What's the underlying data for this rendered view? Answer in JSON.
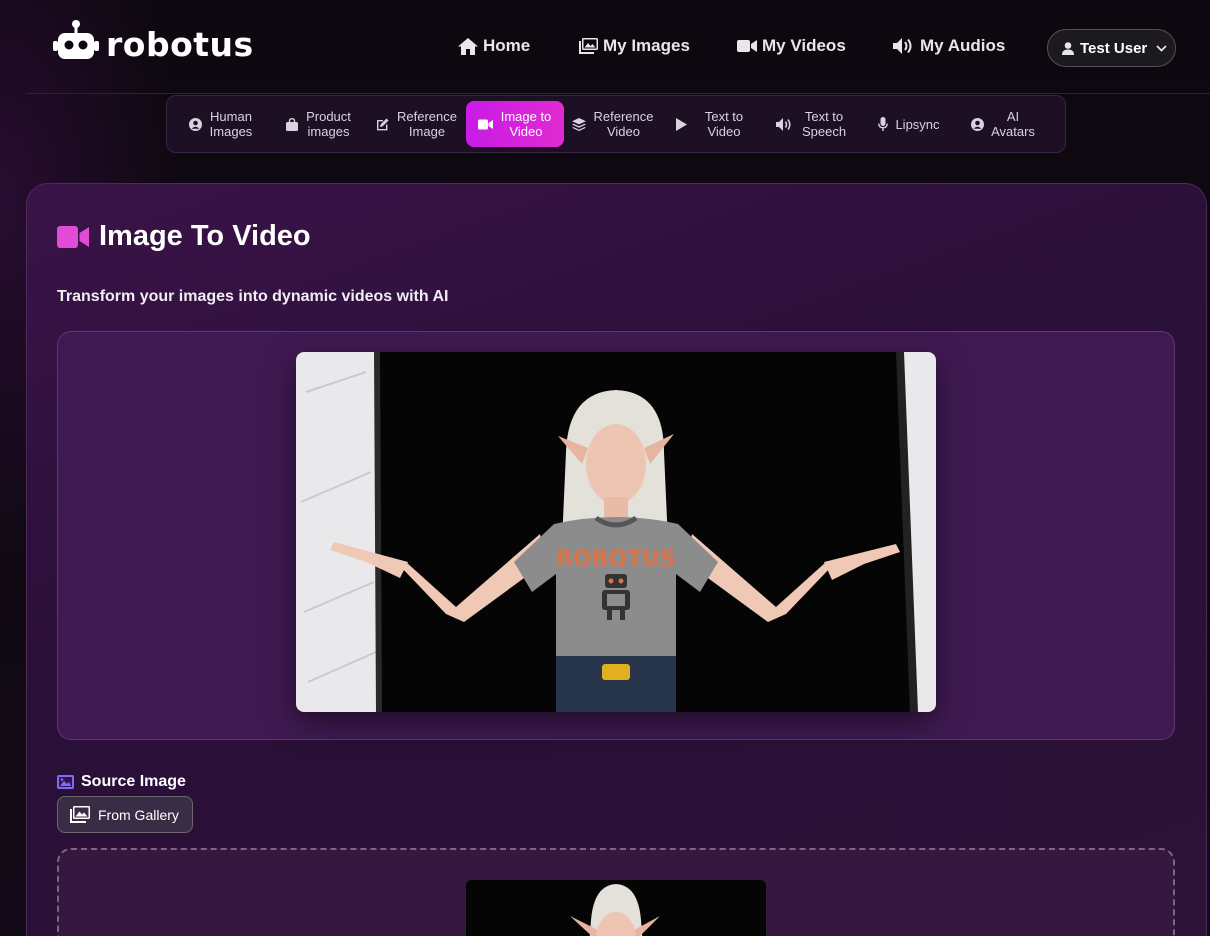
{
  "brand": {
    "name": "robotus"
  },
  "nav": {
    "home": "Home",
    "my_images": "My Images",
    "my_videos": "My Videos",
    "my_audios": "My Audios",
    "user": "Test User"
  },
  "tabs": [
    {
      "label": "Human Images",
      "icon": "user-circle-icon"
    },
    {
      "label": "Product images",
      "icon": "shopping-bag-icon"
    },
    {
      "label": "Reference Image",
      "icon": "edit-icon"
    },
    {
      "label": "Image to Video",
      "icon": "video-camera-icon",
      "active": true
    },
    {
      "label": "Reference Video",
      "icon": "layers-icon"
    },
    {
      "label": "Text to Video",
      "icon": "play-icon"
    },
    {
      "label": "Text to Speech",
      "icon": "volume-icon"
    },
    {
      "label": "Lipsync",
      "icon": "microphone-icon"
    },
    {
      "label": "AI Avatars",
      "icon": "user-circle-icon"
    }
  ],
  "page": {
    "title": "Image To Video",
    "subtitle": "Transform your images into dynamic videos with AI",
    "source_label": "Source Image",
    "gallery_button": "From Gallery"
  },
  "photo_shirt_text": "ROBOTUS",
  "colors": {
    "accent": "#d826e0",
    "title_icon": "#e24bd6",
    "source_icon": "#7b6cff",
    "card_bg": "#33123f"
  }
}
